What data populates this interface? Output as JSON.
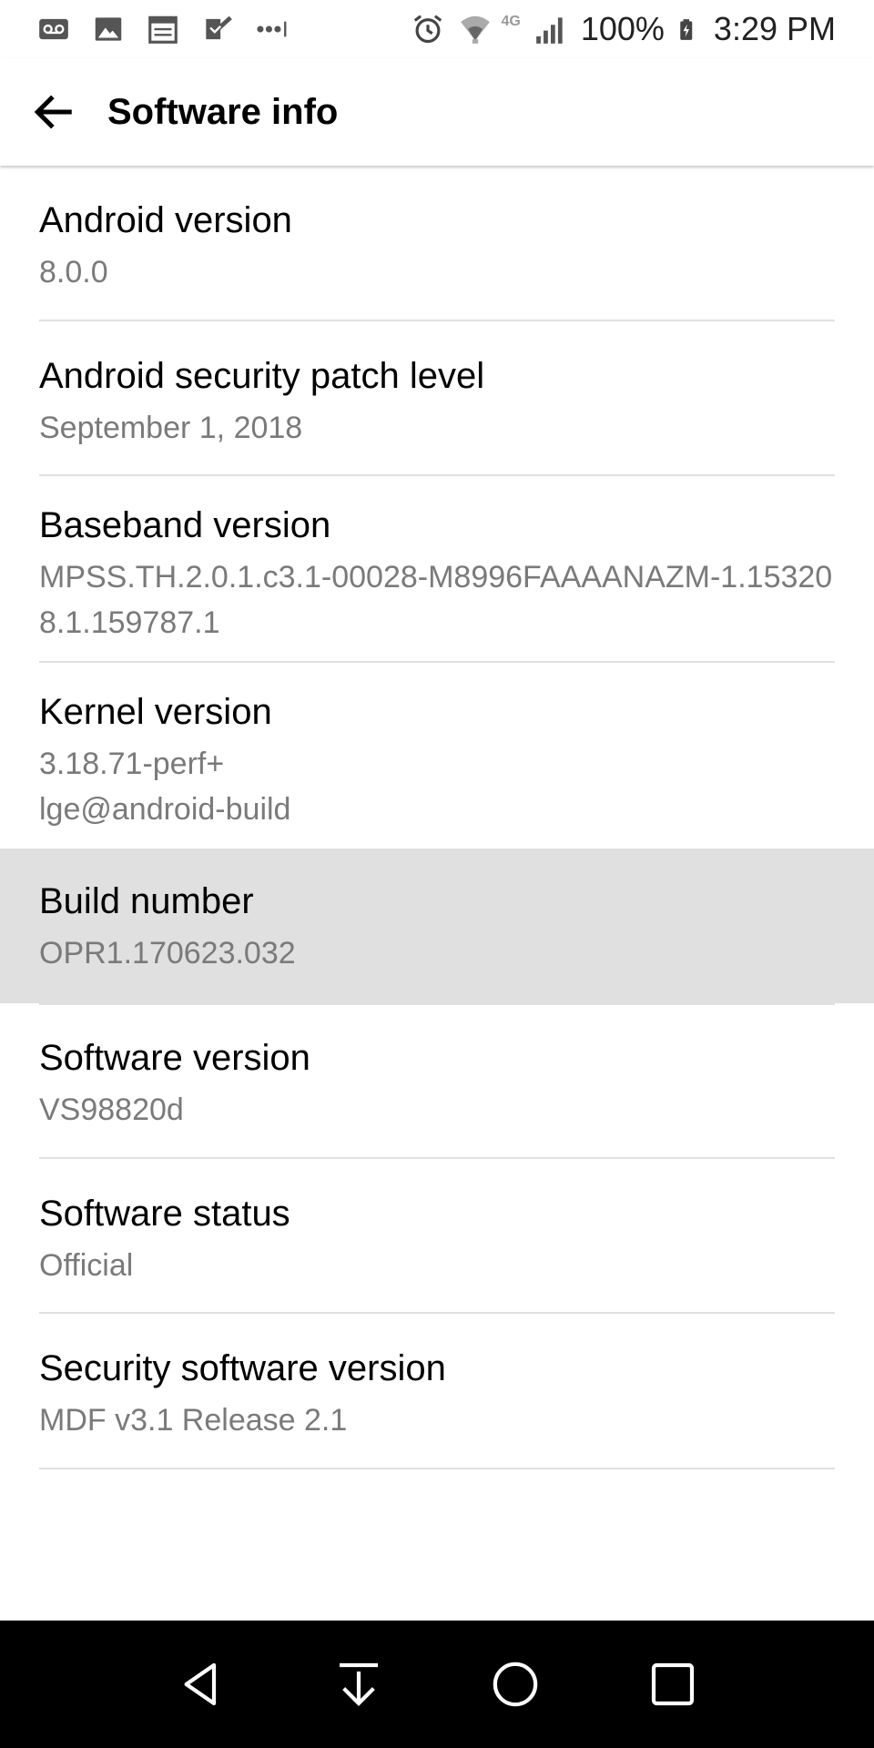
{
  "status_bar": {
    "network_type": "4G",
    "battery_percent": "100%",
    "time": "3:29 PM",
    "icons": [
      "voicemail-icon",
      "image-icon",
      "calendar-icon",
      "checklist-icon",
      "more-notifications-icon",
      "alarm-icon",
      "wifi-icon",
      "signal-icon",
      "battery-charging-icon"
    ]
  },
  "app_bar": {
    "title": "Software info",
    "back_icon": "arrow-back-icon"
  },
  "items": [
    {
      "title": "Android version",
      "value": "8.0.0",
      "highlighted": false
    },
    {
      "title": "Android security patch level",
      "value": "September 1, 2018",
      "highlighted": false
    },
    {
      "title": "Baseband version",
      "value": "MPSS.TH.2.0.1.c3.1-00028-M8996FAAAANAZM-1.153208.1.159787.1",
      "highlighted": false
    },
    {
      "title": "Kernel version",
      "value": "3.18.71-perf+",
      "value2": "lge@android-build",
      "highlighted": false
    },
    {
      "title": "Build number",
      "value": "OPR1.170623.032",
      "highlighted": true
    },
    {
      "title": "Software version",
      "value": "VS98820d",
      "highlighted": false
    },
    {
      "title": "Software status",
      "value": "Official",
      "highlighted": false
    },
    {
      "title": "Security software version",
      "value": "MDF v3.1 Release 2.1",
      "highlighted": false
    }
  ],
  "nav_bar": {
    "buttons": [
      "back-triangle-icon",
      "notification-pull-icon",
      "home-circle-icon",
      "recents-square-icon"
    ]
  },
  "colors": {
    "highlight": "#e0e0e0",
    "divider": "#e0e0e0",
    "secondary_text": "#7a7a7a",
    "nav_background": "#000000"
  }
}
